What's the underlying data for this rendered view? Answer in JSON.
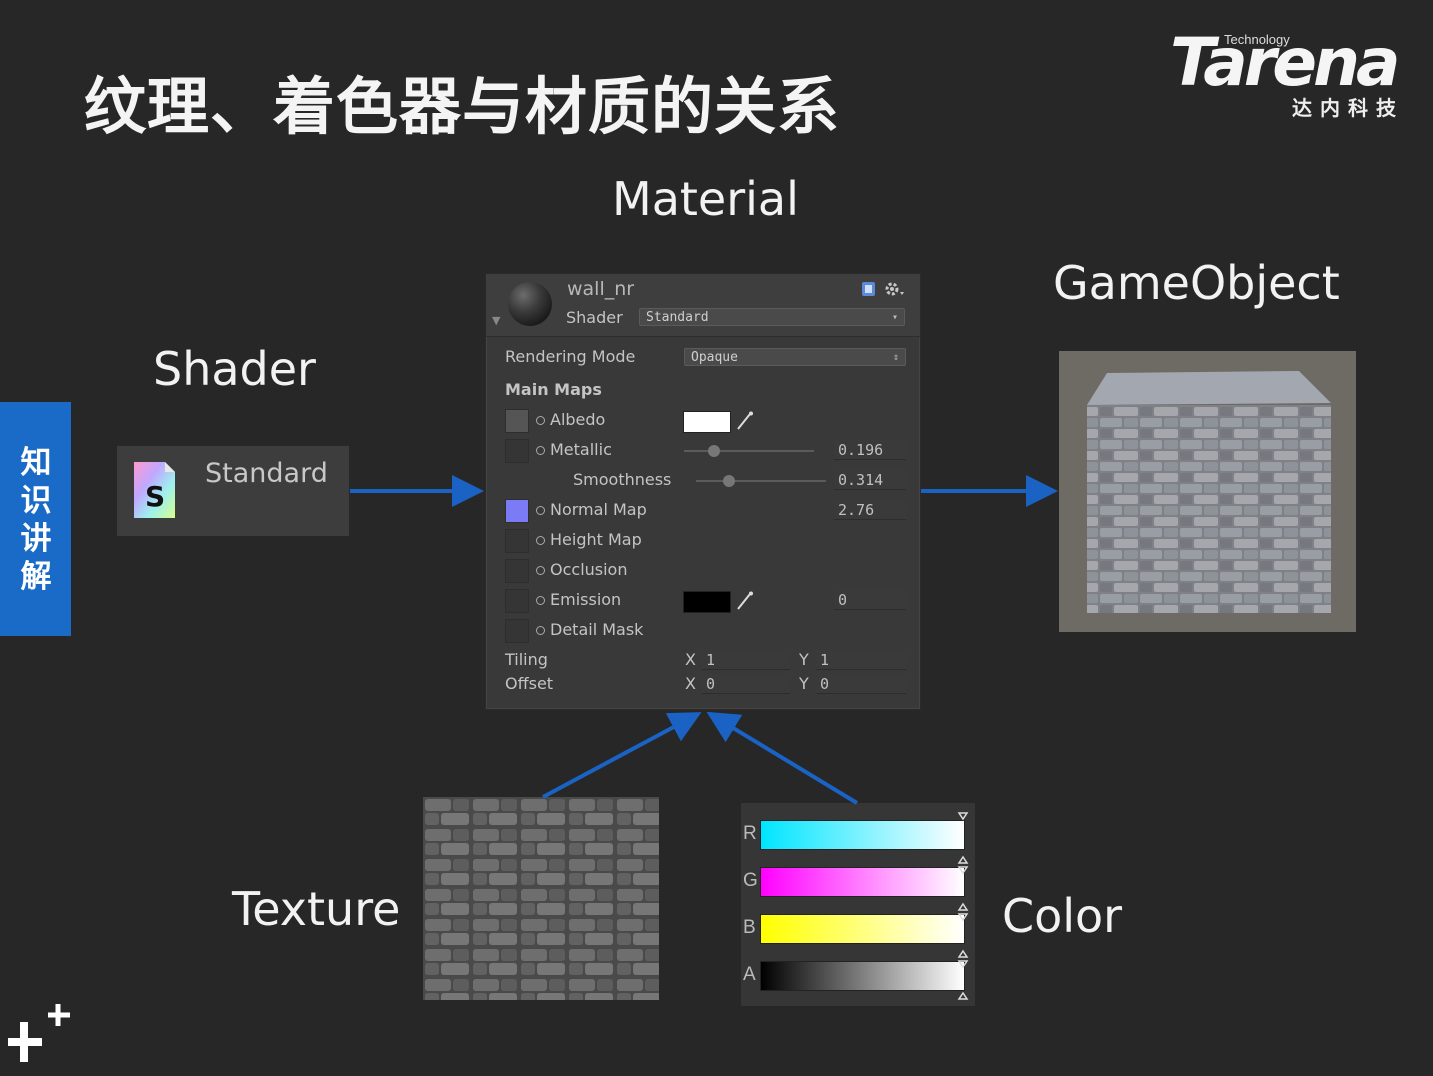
{
  "slide": {
    "title": "纹理、着色器与材质的关系",
    "side_tab": "知识讲解"
  },
  "logo": {
    "brand": "Tarena",
    "tagline": "Technology",
    "chinese": "达内科技"
  },
  "labels": {
    "material": "Material",
    "shader": "Shader",
    "gameobject": "GameObject",
    "texture": "Texture",
    "color": "Color"
  },
  "shader_card": {
    "name": "Standard",
    "icon": "shader-s-icon"
  },
  "inspector": {
    "name": "wall_nr",
    "shader_label": "Shader",
    "shader_value": "Standard",
    "rendering_mode_label": "Rendering Mode",
    "rendering_mode_value": "Opaque",
    "main_maps_label": "Main Maps",
    "albedo": "Albedo",
    "metallic": "Metallic",
    "metallic_value": "0.196",
    "smoothness": "Smoothness",
    "smoothness_value": "0.314",
    "normal_map": "Normal Map",
    "normal_map_value": "2.76",
    "height_map": "Height Map",
    "occlusion": "Occlusion",
    "emission": "Emission",
    "emission_value": "0",
    "detail_mask": "Detail Mask",
    "tiling_label": "Tiling",
    "offset_label": "Offset",
    "axis_x": "X",
    "axis_y": "Y",
    "tiling_x": "1",
    "tiling_y": "1",
    "offset_x": "0",
    "offset_y": "0",
    "colors": {
      "albedo": "#ffffff",
      "emission": "#000000",
      "normal_thumb": "#7b7bf5"
    }
  },
  "color_panel": {
    "channels": [
      "R",
      "G",
      "B",
      "A"
    ],
    "colors": [
      "#00e5ff",
      "#ff00ff",
      "#ffff00",
      "#000000"
    ]
  },
  "arrow_color": "#1a63c4"
}
